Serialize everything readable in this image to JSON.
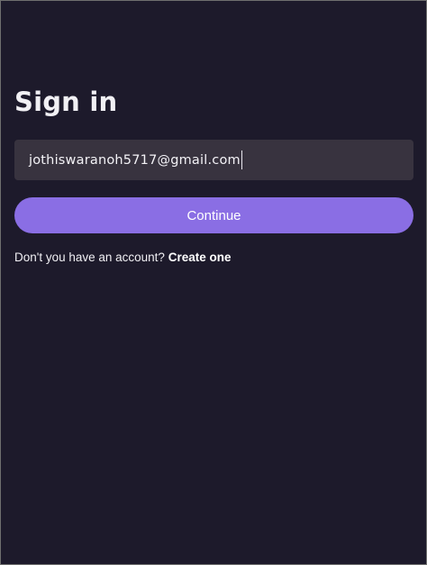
{
  "signin": {
    "title": "Sign in",
    "email_value": "jothiswaranoh5717@gmail.com",
    "continue_label": "Continue",
    "signup_prompt": "Don't you have an account?",
    "signup_link": "Create one"
  },
  "colors": {
    "background": "#1d1a2b",
    "input_background": "#38333f",
    "accent": "#8a6ee4",
    "text": "#f1f0f4"
  }
}
